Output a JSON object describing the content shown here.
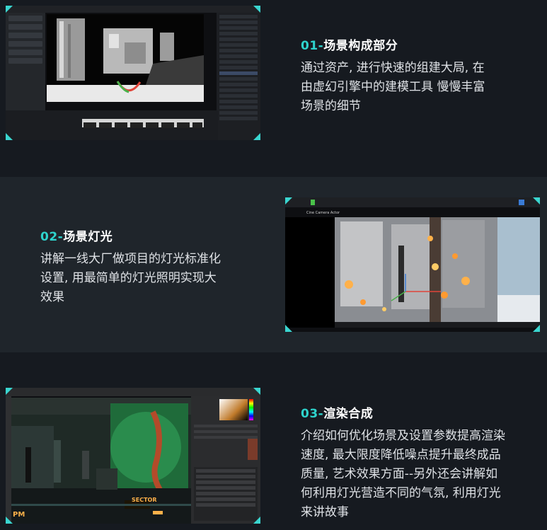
{
  "sections": [
    {
      "num": "01-",
      "title": "场景构成部分",
      "lines": [
        "通过资产, 进行快速的组建大局, 在",
        "由虚幻引擎中的建模工具 慢慢丰富",
        "场景的细节"
      ]
    },
    {
      "num": "02-",
      "title": "场景灯光",
      "lines": [
        "讲解一线大厂做项目的灯光标准化",
        "设置, 用最简单的灯光照明实现大",
        "效果"
      ]
    },
    {
      "num": "03-",
      "title": "渲染合成",
      "lines": [
        "介绍如何优化场景及设置参数提高渲染",
        "速度, 最大限度降低噪点提升最终成品",
        "质量, 艺术效果方面--另外还会讲解如",
        "何利用灯光营造不同的气氛, 利用灯光",
        "来讲故事"
      ]
    }
  ],
  "screenshots": {
    "s2_tab": "Cine Camera Actor",
    "s3_sign": "SECTOR",
    "s3_sign2": "PM"
  },
  "colors": {
    "accent": "#2ed3cc",
    "background": "#161a20",
    "band_alt": "#1f252b"
  }
}
